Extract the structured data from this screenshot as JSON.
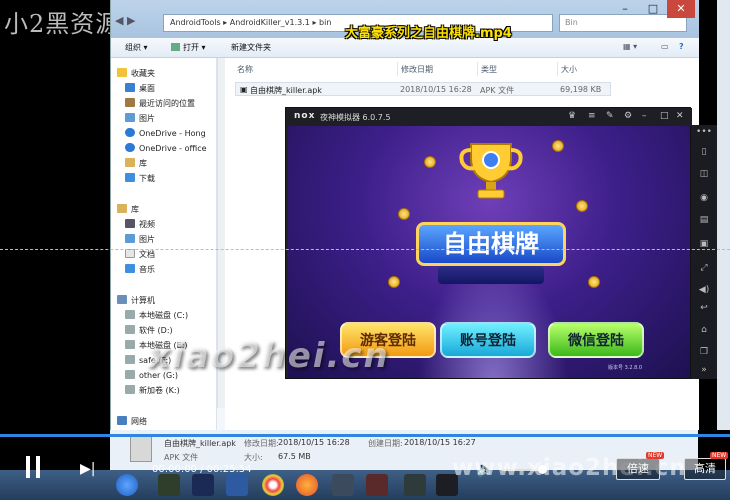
{
  "watermarks": {
    "top_left": "小2黑资源",
    "center": "xiao2hei.cn",
    "bottom": "www.xiao2hei.cn"
  },
  "video": {
    "title": "大富豪系列之自由棋牌.mp4",
    "current_time": "00:00:00",
    "total_time": "00:25:54",
    "time_separator": " / ",
    "speed_label": "倍速",
    "quality_label": "高清",
    "new_badge": "NEW"
  },
  "explorer": {
    "address_segments": [
      "AndroidTools",
      "AndroidKiller_v1.3.1",
      "bin"
    ],
    "search_text": "Bin",
    "toolbar": {
      "organize": "组织 ▾",
      "open": "打开 ▾",
      "new_folder": "新建文件夹"
    },
    "sidebar": {
      "favorites": [
        {
          "label": "收藏夹",
          "icon": "star-icon"
        },
        {
          "label": "桌面",
          "icon": "desktop-icon"
        },
        {
          "label": "最近访问的位置",
          "icon": "recent-icon"
        },
        {
          "label": "图片",
          "icon": "picture-icon"
        },
        {
          "label": "OneDrive - Hong",
          "icon": "cloud-icon"
        },
        {
          "label": "OneDrive - office",
          "icon": "cloud-icon"
        },
        {
          "label": "库",
          "icon": "library-icon"
        },
        {
          "label": "下载",
          "icon": "download-icon"
        }
      ],
      "libraries": [
        {
          "label": "库",
          "icon": "library-icon"
        },
        {
          "label": "视频",
          "icon": "video-icon"
        },
        {
          "label": "图片",
          "icon": "picture-icon"
        },
        {
          "label": "文档",
          "icon": "document-icon"
        },
        {
          "label": "音乐",
          "icon": "music-icon"
        }
      ],
      "computer": [
        {
          "label": "计算机",
          "icon": "computer-icon"
        },
        {
          "label": "本地磁盘 (C:)",
          "icon": "drive-icon"
        },
        {
          "label": "软件 (D:)",
          "icon": "drive-icon"
        },
        {
          "label": "本地磁盘 (E:)",
          "icon": "drive-icon"
        },
        {
          "label": "safe (F:)",
          "icon": "drive-icon"
        },
        {
          "label": "other (G:)",
          "icon": "drive-icon"
        },
        {
          "label": "新加卷 (K:)",
          "icon": "drive-icon"
        }
      ],
      "network": {
        "label": "网络",
        "icon": "network-icon"
      }
    },
    "columns": [
      "名称",
      "修改日期",
      "类型",
      "大小"
    ],
    "files": [
      {
        "name": "自由棋牌_killer.apk",
        "modified": "2018/10/15 16:28",
        "type": "APK 文件",
        "size": "69,198 KB"
      }
    ],
    "details": {
      "name": "自由棋牌_killer.apk",
      "modified_label": "修改日期:",
      "modified": "2018/10/15 16:28",
      "created_label": "创建日期:",
      "created": "2018/10/15 16:27",
      "type": "APK 文件",
      "size_label": "大小:",
      "size": "67.5 MB"
    }
  },
  "emulator": {
    "logo": "nox",
    "name": "夜神模拟器 6.0.7.5",
    "game": {
      "logo_text": "自由棋牌",
      "guest_login": "游客登陆",
      "account_login": "账号登陆",
      "wechat_login": "微信登陆",
      "version": "版本号 3.2.8.0"
    }
  },
  "colors": {
    "progress": "#2f86e0",
    "title_yellow": "#ffe100",
    "emulator_dark": "#1e1f25"
  }
}
